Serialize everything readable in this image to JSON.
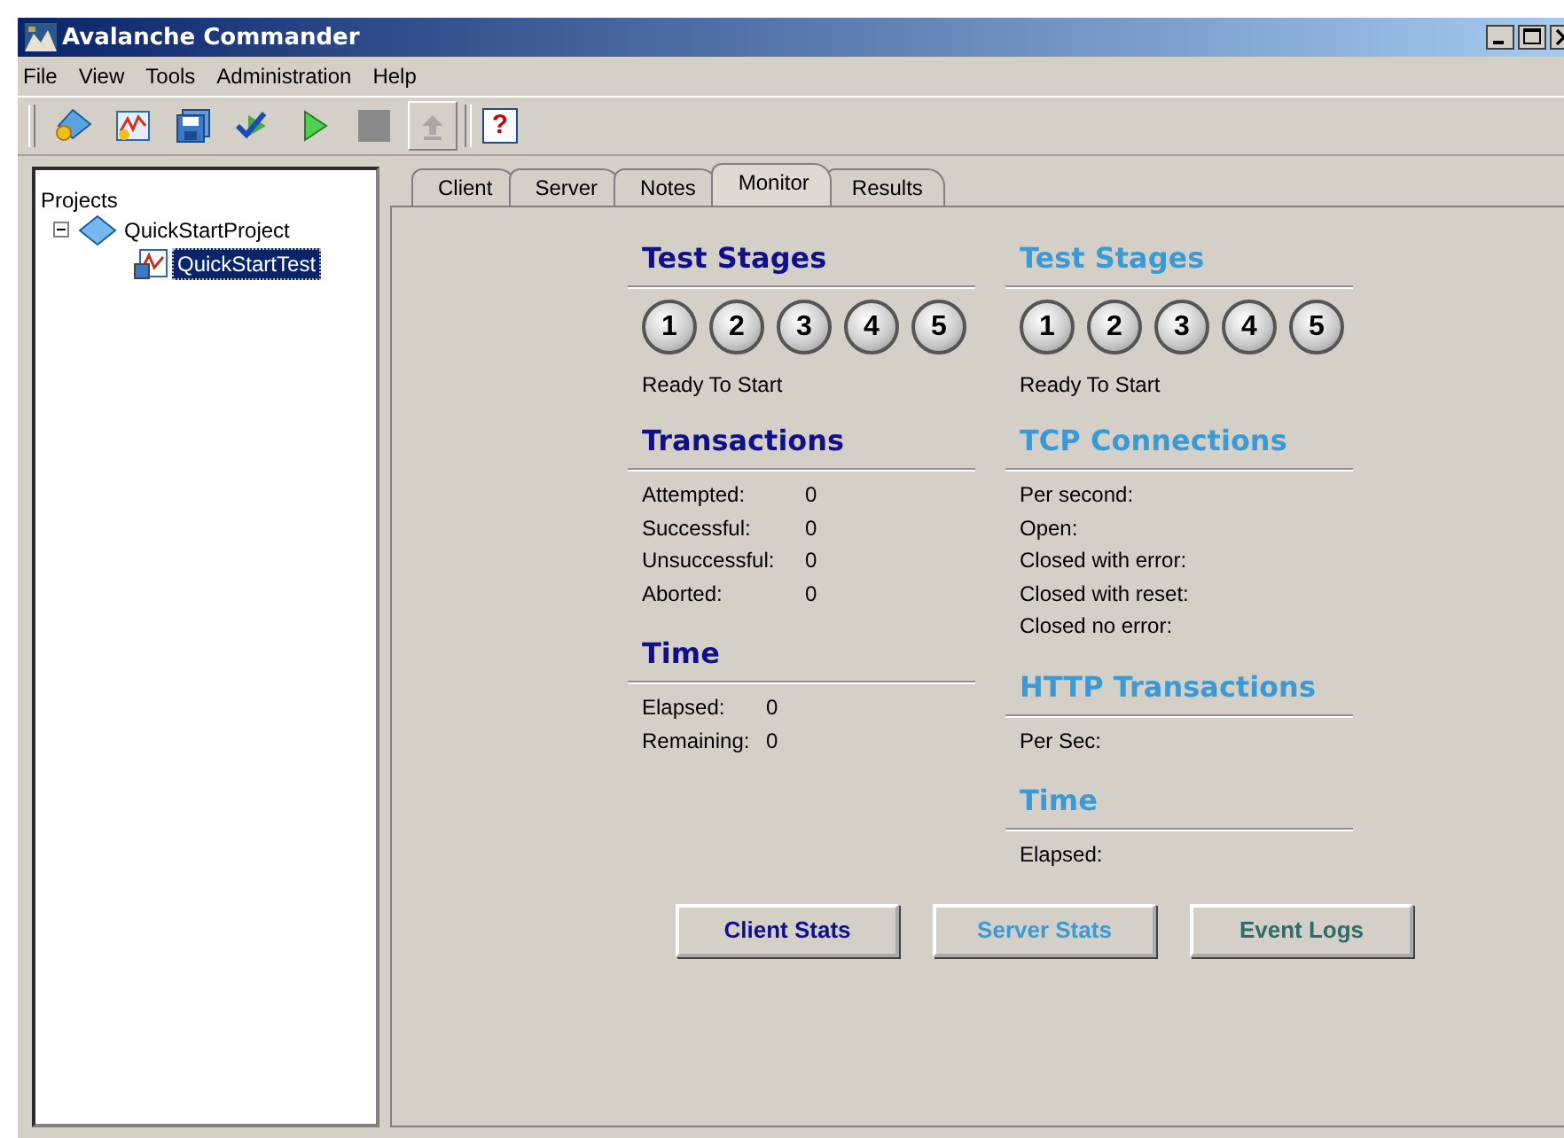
{
  "window": {
    "title": "Avalanche Commander"
  },
  "menu": [
    "File",
    "View",
    "Tools",
    "Administration",
    "Help"
  ],
  "toolbar": [
    {
      "kind": "project",
      "disabled": false
    },
    {
      "kind": "chart",
      "disabled": false
    },
    {
      "kind": "save",
      "disabled": false
    },
    {
      "kind": "check",
      "disabled": false
    },
    {
      "kind": "play",
      "disabled": false
    },
    {
      "kind": "stop",
      "disabled": true
    },
    {
      "kind": "upload",
      "disabled": true
    },
    {
      "kind": "help",
      "disabled": false,
      "label": "?"
    }
  ],
  "tree": {
    "label": "Projects",
    "children": [
      {
        "label": "QuickStartProject",
        "expanded": true,
        "selected": false,
        "children": [
          {
            "label": "QuickStartTest",
            "selected": true
          }
        ]
      }
    ]
  },
  "tabs": [
    {
      "label": "Client",
      "selected": false
    },
    {
      "label": "Server",
      "selected": false
    },
    {
      "label": "Notes",
      "selected": false
    },
    {
      "label": "Monitor",
      "selected": true
    },
    {
      "label": "Results",
      "selected": false
    }
  ],
  "columns": [
    {
      "color": "#10108c",
      "sections": [
        {
          "kind": "stages",
          "title": "Test Stages",
          "stages": [
            "1",
            "2",
            "3",
            "4",
            "5"
          ],
          "status": "Ready To Start"
        },
        {
          "kind": "stats",
          "title": "Transactions",
          "rows": [
            {
              "label": "Attempted:",
              "value": "0"
            },
            {
              "label": "Successful:",
              "value": "0"
            },
            {
              "label": "Unsuccessful:",
              "value": "0"
            },
            {
              "label": "Aborted:",
              "value": "0"
            }
          ]
        },
        {
          "kind": "stats",
          "title": "Time",
          "rows": [
            {
              "label": "Elapsed:",
              "value": "0"
            },
            {
              "label": "Remaining:",
              "value": "0"
            }
          ]
        }
      ]
    },
    {
      "color": "#3a9ad6",
      "sections": [
        {
          "kind": "stages",
          "title": "Test Stages",
          "stages": [
            "1",
            "2",
            "3",
            "4",
            "5"
          ],
          "status": "Ready To Start"
        },
        {
          "kind": "stats",
          "title": "TCP Connections",
          "rows": [
            {
              "label": "Per second:"
            },
            {
              "label": "Open:"
            },
            {
              "label": "Closed with error:"
            },
            {
              "label": "Closed with reset:"
            },
            {
              "label": "Closed no error:"
            }
          ]
        },
        {
          "kind": "stats",
          "title": "HTTP Transactions",
          "rows": [
            {
              "label": "Per Sec:"
            }
          ]
        },
        {
          "kind": "stats",
          "title": "Time",
          "rows": [
            {
              "label": "Elapsed:"
            }
          ]
        }
      ]
    }
  ],
  "buttons": [
    {
      "label": "Client Stats",
      "color": "#10108c"
    },
    {
      "label": "Server Stats",
      "color": "#3a9ad6"
    },
    {
      "label": "Event Logs",
      "color": "#2f6b6b"
    }
  ]
}
